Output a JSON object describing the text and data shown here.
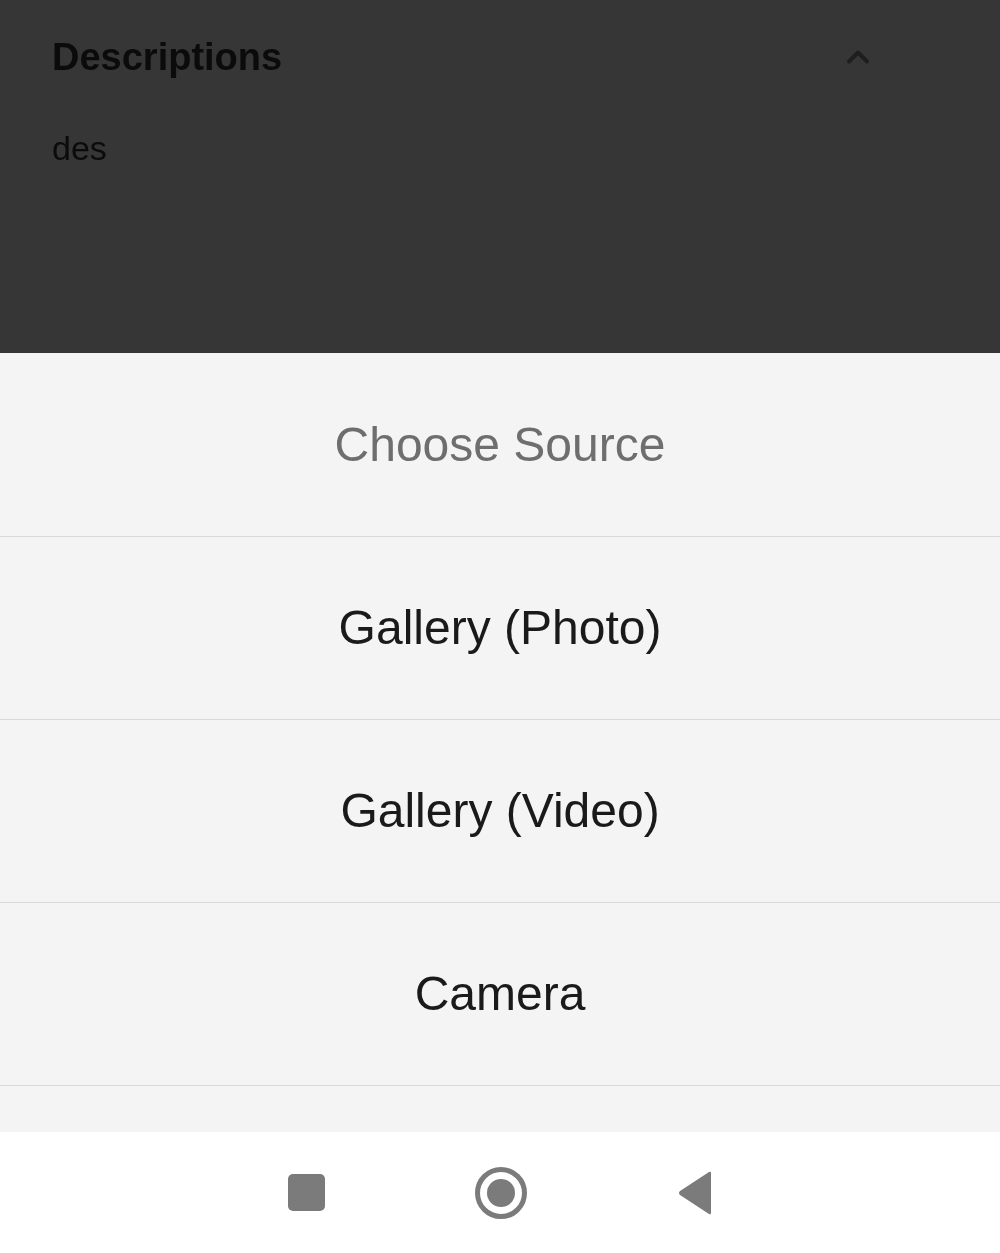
{
  "section": {
    "title": "Descriptions",
    "expanded": true,
    "body": "des"
  },
  "action_sheet": {
    "title": "Choose Source",
    "options": [
      "Gallery (Photo)",
      "Gallery (Video)",
      "Camera"
    ]
  }
}
